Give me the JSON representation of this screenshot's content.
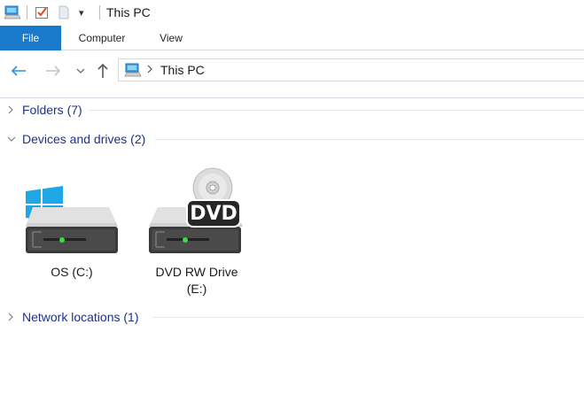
{
  "window": {
    "title": "This PC",
    "qa_dropdown_glyph": "▾"
  },
  "ribbon": {
    "tabs": [
      {
        "label": "File",
        "active": true
      },
      {
        "label": "Computer",
        "active": false
      },
      {
        "label": "View",
        "active": false
      }
    ],
    "accent_color": "#1979ca"
  },
  "navigation": {
    "back_glyph": "←",
    "forward_glyph": "→",
    "recent_glyph": "⌄",
    "up_glyph": "↑",
    "address": {
      "segments": [
        "This PC"
      ]
    }
  },
  "groups": {
    "folders": {
      "label": "Folders (7)",
      "expanded": false
    },
    "devices": {
      "label": "Devices and drives (2)",
      "expanded": true
    },
    "network": {
      "label": "Network locations (1)",
      "expanded": false
    }
  },
  "drives": [
    {
      "label": "OS (C:)",
      "icon": "hard-drive-windows-icon"
    },
    {
      "label_line1": "DVD RW Drive",
      "label_line2": "(E:)",
      "icon": "dvd-drive-icon",
      "badge": "DVD"
    }
  ],
  "colors": {
    "group_text": "#1e3287",
    "led_green": "#3ddc3d",
    "windows_blue": "#1fa8e6"
  }
}
